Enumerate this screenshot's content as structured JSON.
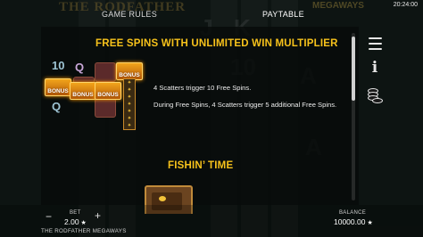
{
  "top_bar": {
    "tabs": [
      "GAME RULES",
      "PAYTABLE"
    ],
    "active_tab": "PAYTABLE",
    "clock": "20:24:00",
    "bg_logo_left": "THE RODFATHER",
    "bg_logo_right": "MEGAWAYS"
  },
  "paytable": {
    "free_spins": {
      "title": "FREE SPINS WITH UNLIMITED WIN MULTIPLIER",
      "lines": [
        "4 Scatters trigger 10 Free Spins.",
        "During Free Spins, 4 Scatters trigger 5 additional Free Spins."
      ],
      "illustration": {
        "bonus_label": "BONUS",
        "background_symbols": [
          "10",
          "Q",
          "Q"
        ]
      }
    },
    "fishin_time": {
      "title": "FISHIN’ TIME"
    }
  },
  "side_menu": {
    "items": [
      "menu-icon",
      "info-icon",
      "coins-icon"
    ]
  },
  "bottom_bar": {
    "bet_label": "BET",
    "bet_value": "2.00",
    "balance_label": "BALANCE",
    "balance_value": "10000.00",
    "currency_symbol": "★",
    "minus": "−",
    "plus": "+",
    "game_name": "THE RODFATHER MEGAWAYS"
  }
}
